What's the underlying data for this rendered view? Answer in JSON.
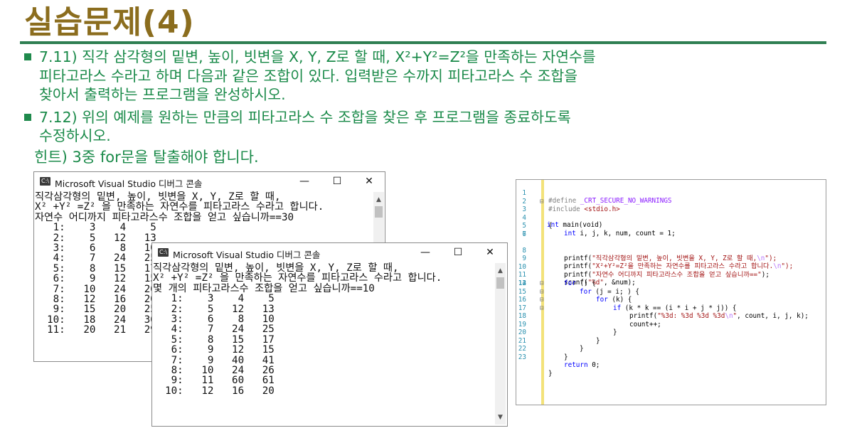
{
  "title": "실습문제(4)",
  "bullets": [
    {
      "lines": [
        "7.11) 직각 삼각형의 밑변, 높이, 빗변을 X, Y, Z로 할 때, X²+Y²=Z²을 만족하는 자연수를",
        "피타고라스 수라고 하며 다음과 같은 조합이 있다. 입력받은 수까지 피타고라스 수 조합을",
        "찾아서 출력하는 프로그램을 완성하시오."
      ]
    },
    {
      "lines": [
        "7.12) 위의 예제를 원하는 만큼의 피타고라스 수 조합을 찾은 후 프로그램을 종료하도록",
        "수정하시오."
      ]
    }
  ],
  "hint": "힌트) 3중 for문을 탈출해야 합니다.",
  "console1": {
    "icon": "C:\\",
    "title": "Microsoft Visual Studio 디버그 콘솔",
    "minimize": "—",
    "maximize": "☐",
    "close": "✕",
    "text": "직각삼각형의 밑변, 높이, 빗변을 X, Y, Z로 할 때,\nX² +Y² =Z² 을 만족하는 자연수를 피타고라스 수라고 합니다.\n자연수 어디까지 피타고라스수 조합을 얻고 싶습니까==30\n   1:    3    4    5\n   2:    5   12   13\n   3:    6    8   10\n   4:    7   24   25\n   5:    8   15   17\n   6:    9   12   15\n   7:   10   24   26\n   8:   12   16   20\n   9:   15   20   25\n  10:   18   24   30\n  11:   20   21   29"
  },
  "console2": {
    "icon": "C:\\",
    "title": "Microsoft Visual Studio 디버그 콘솔",
    "minimize": "—",
    "maximize": "☐",
    "close": "✕",
    "text": "직각삼각형의 밑변, 높이, 빗변을 X, Y, Z로 할 때,\nX² +Y² =Z² 을 만족하는 자연수를 피타고라스 수라고 합니다.\n몇 개의 피타고라스수 조합을 얻고 싶습니까==10\n   1:    3    4    5\n   2:    5   12   13\n   3:    6    8   10\n   4:    7   24   25\n   5:    8   15   17\n   6:    9   12   15\n   7:    9   40   41\n   8:   10   24   26\n   9:   11   60   61\n  10:   12   16   20"
  },
  "code": {
    "line_numbers": [
      "1",
      "2",
      "3",
      "4",
      "5",
      "6",
      "7",
      "8",
      "9",
      "10",
      "11",
      "12",
      "13",
      "14",
      "15",
      "16",
      "17",
      "18",
      "19",
      "20",
      "21",
      "22",
      "23"
    ],
    "l1_kw": "#define",
    "l1_macro": "_CRT_SECURE_NO_WARNINGS",
    "l2_kw": "#include",
    "l2_str": "<stdio.h>",
    "l3_kw": "int",
    "l3_rest": "main(void)",
    "l4": "{",
    "l5_kw": "int",
    "l5_rest": "i, j, k, num, count = 1;",
    "l7_fn": "printf(",
    "l7_str": "\"직각삼각형의 밑변, 높이, 빗변을 X, Y, Z로 할 때,",
    "l7_esc": "\\n",
    "l7_end": "\");",
    "l8_fn": "printf(",
    "l8_str": "\"X²+Y²=Z²을 만족하는 자연수를 피타고라스 수라고 합니다.",
    "l8_esc": "\\n",
    "l8_end": "\");",
    "l9_fn": "printf(",
    "l9_str": "\"자연수 어디까지 피타고라스수 조합을 얻고 싶습니까==\"",
    "l9_end": ");",
    "l10_fn": "scanf(",
    "l10_str": "\"%d\"",
    "l10_end": ", &num);",
    "l12_kw": "for",
    "l12_rest": " () {",
    "l13_kw": "for",
    "l13_rest": " (j = i; ) {",
    "l14_kw": "for",
    "l14_rest": " (k) {",
    "l15_kw": "if",
    "l15_rest": " (k * k == (i * i + j * j)) {",
    "l16_fn": "printf(",
    "l16_str": "\"%3d: %3d %3d %3d",
    "l16_esc": "\\n",
    "l16_strend": "\"",
    "l16_end": ", count, i, j, k);",
    "l17": "count++;",
    "l18": "}",
    "l19": "}",
    "l20": "}",
    "l21": "}",
    "l22_kw": "return",
    "l22_rest": " 0;",
    "l23": "}",
    "fold_marks": [
      "⊟",
      "⊟",
      "⊟",
      "⊟",
      "⊟"
    ]
  }
}
